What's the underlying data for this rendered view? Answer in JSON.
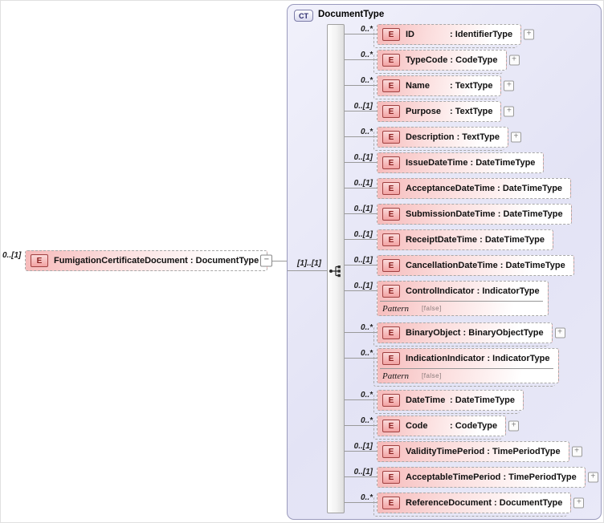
{
  "labels": {
    "element_badge": "E",
    "expand_icon": "+",
    "collapse_icon": "−"
  },
  "root_element": {
    "cardinality": "0..[1]",
    "name": "FumigationCertificateDocument",
    "type_label": " : DocumentType"
  },
  "complex_type": {
    "badge": "CT",
    "title": "DocumentType",
    "group_cardinality": "[1]..[1]",
    "model_group": "sequence",
    "elements": [
      {
        "name": "ID",
        "type_label": " : IdentifierType",
        "cardinality": "0..*",
        "multi": true,
        "expandable": true,
        "pattern": null
      },
      {
        "name": "TypeCode",
        "type_label": " : CodeType",
        "cardinality": "0..*",
        "multi": true,
        "expandable": true,
        "pattern": null
      },
      {
        "name": "Name",
        "type_label": " : TextType",
        "cardinality": "0..*",
        "multi": true,
        "expandable": true,
        "pattern": null
      },
      {
        "name": "Purpose",
        "type_label": " : TextType",
        "cardinality": "0..[1]",
        "multi": false,
        "expandable": true,
        "pattern": null
      },
      {
        "name": "Description",
        "type_label": " : TextType",
        "cardinality": "0..*",
        "multi": true,
        "expandable": true,
        "pattern": null
      },
      {
        "name": "IssueDateTime",
        "type_label": " : DateTimeType",
        "cardinality": "0..[1]",
        "multi": false,
        "expandable": false,
        "pattern": null
      },
      {
        "name": "AcceptanceDateTime",
        "type_label": " : DateTimeType",
        "cardinality": "0..[1]",
        "multi": false,
        "expandable": false,
        "pattern": null
      },
      {
        "name": "SubmissionDateTime",
        "type_label": " : DateTimeType",
        "cardinality": "0..[1]",
        "multi": false,
        "expandable": false,
        "pattern": null
      },
      {
        "name": "ReceiptDateTime",
        "type_label": " : DateTimeType",
        "cardinality": "0..[1]",
        "multi": false,
        "expandable": false,
        "pattern": null
      },
      {
        "name": "CancellationDateTime",
        "type_label": " : DateTimeType",
        "cardinality": "0..[1]",
        "multi": false,
        "expandable": false,
        "pattern": null
      },
      {
        "name": "ControlIndicator",
        "type_label": " : IndicatorType",
        "cardinality": "0..[1]",
        "multi": false,
        "expandable": false,
        "pattern": {
          "label": "Pattern",
          "value": "[false]"
        }
      },
      {
        "name": "BinaryObject",
        "type_label": " : BinaryObjectType",
        "cardinality": "0..*",
        "multi": true,
        "expandable": true,
        "pattern": null
      },
      {
        "name": "IndicationIndicator",
        "type_label": " : IndicatorType",
        "cardinality": "0..*",
        "multi": true,
        "expandable": false,
        "pattern": {
          "label": "Pattern",
          "value": "[false]"
        }
      },
      {
        "name": "DateTime",
        "type_label": " : DateTimeType",
        "cardinality": "0..*",
        "multi": true,
        "expandable": false,
        "pattern": null
      },
      {
        "name": "Code",
        "type_label": " : CodeType",
        "cardinality": "0..*",
        "multi": true,
        "expandable": true,
        "pattern": null
      },
      {
        "name": "ValidityTimePeriod",
        "type_label": " : TimePeriodType",
        "cardinality": "0..[1]",
        "multi": false,
        "expandable": true,
        "pattern": null
      },
      {
        "name": "AcceptableTimePeriod",
        "type_label": " : TimePeriodType",
        "cardinality": "0..[1]",
        "multi": false,
        "expandable": true,
        "pattern": null
      },
      {
        "name": "ReferenceDocument",
        "type_label": " : DocumentType",
        "cardinality": "0..*",
        "multi": true,
        "expandable": true,
        "pattern": null
      }
    ]
  },
  "colors": {
    "element_fill_left": "#f6baba",
    "element_border": "#a8a8a8",
    "badge_border": "#a04040",
    "badge_text": "#8b2020",
    "container_fill": "#e3e3f5",
    "container_border": "#9a9abd",
    "ct_badge_text": "#2c2c6e",
    "connector": "#9a9a9a"
  }
}
